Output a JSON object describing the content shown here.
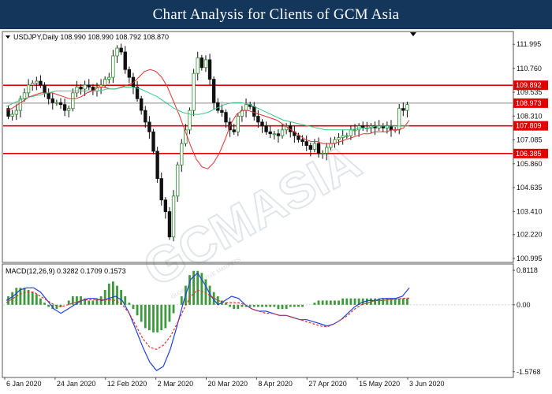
{
  "header": {
    "title": "Chart Analysis for Clients of GCM Asia"
  },
  "colors": {
    "banner_bg": "#13365a",
    "candle_up": "#2e8b2e",
    "candle_down": "#111111",
    "ma_fast": "#e53030",
    "ma_slow": "#38c98a",
    "level_line": "#e00000",
    "level_label_bg": "#e00000",
    "current_price_bg": "#e00000",
    "macd_hist": "#3c9a3c",
    "macd_line": "#2040e0",
    "signal_line": "#e03030",
    "watermark": "#d8dde2"
  },
  "chart_data": [
    {
      "type": "candlestick",
      "header_text": "USDJPY,Daily  108.990 108.990 108.792 108.870",
      "ohlc": {
        "symbol": "USDJPY",
        "timeframe": "Daily",
        "open": 108.99,
        "high": 108.99,
        "low": 108.792,
        "close": 108.87
      },
      "y_ticks": [
        "111.995",
        "110.760",
        "109.535",
        "108.310",
        "107.085",
        "105.860",
        "104.635",
        "103.410",
        "102.220",
        "100.995"
      ],
      "y_tick_values": [
        111.995,
        110.76,
        109.535,
        108.31,
        107.085,
        105.86,
        104.635,
        103.41,
        102.22,
        100.995
      ],
      "ylim": [
        100.995,
        112.45
      ],
      "x_ticks": [
        "6 Jan 2020",
        "24 Jan 2020",
        "12 Feb 2020",
        "2 Mar 2020",
        "20 Mar 2020",
        "8 Apr 2020",
        "27 Apr 2020",
        "15 May 2020",
        "3 Jun 2020"
      ],
      "levels": [
        {
          "label": "109.892",
          "value": 109.892
        },
        {
          "label": "107.809",
          "value": 107.809
        },
        {
          "label": "106.385",
          "value": 106.385
        }
      ],
      "current_price": {
        "label": "108.973",
        "value": 108.973
      },
      "close_series": [
        108.3,
        108.4,
        108.6,
        109.2,
        109.5,
        109.9,
        110.0,
        110.1,
        109.9,
        109.5,
        109.2,
        109.0,
        109.0,
        108.9,
        108.6,
        108.7,
        109.5,
        109.8,
        109.7,
        109.9,
        109.8,
        109.6,
        109.8,
        109.9,
        110.2,
        110.3,
        111.4,
        111.8,
        111.6,
        110.7,
        110.3,
        109.8,
        109.2,
        108.6,
        108.0,
        107.5,
        106.5,
        105.1,
        104.0,
        103.4,
        102.1,
        104.2,
        105.8,
        106.9,
        107.6,
        108.6,
        110.5,
        111.3,
        110.8,
        111.2,
        110.2,
        109.0,
        108.6,
        108.5,
        108.0,
        107.6,
        107.5,
        108.3,
        108.6,
        108.9,
        108.8,
        108.3,
        108.0,
        107.8,
        107.5,
        107.4,
        107.4,
        107.3,
        107.6,
        107.8,
        107.5,
        107.3,
        107.1,
        107.0,
        106.8,
        106.6,
        106.9,
        106.4,
        106.4,
        106.7,
        106.9,
        107.1,
        107.2,
        107.3,
        107.3,
        107.6,
        107.6,
        107.8,
        107.7,
        107.7,
        107.8,
        107.7,
        107.8,
        107.7,
        107.8,
        107.6,
        107.6,
        108.7,
        108.6,
        108.9
      ],
      "open_series": [
        108.7,
        108.3,
        108.4,
        108.6,
        109.2,
        109.5,
        109.9,
        110.0,
        110.1,
        109.9,
        109.5,
        109.2,
        109.0,
        109.0,
        108.9,
        108.6,
        108.7,
        109.5,
        109.8,
        109.7,
        109.9,
        109.8,
        109.6,
        109.8,
        109.9,
        110.2,
        110.3,
        111.4,
        111.8,
        111.6,
        110.7,
        110.3,
        109.8,
        109.2,
        108.6,
        108.0,
        107.5,
        106.5,
        105.1,
        104.0,
        103.4,
        102.1,
        104.2,
        105.8,
        106.9,
        107.6,
        108.6,
        110.5,
        111.3,
        110.8,
        111.2,
        110.2,
        109.0,
        108.6,
        108.5,
        108.0,
        107.6,
        107.5,
        108.3,
        108.6,
        108.9,
        108.8,
        108.3,
        108.0,
        107.8,
        107.5,
        107.4,
        107.4,
        107.3,
        107.6,
        107.8,
        107.5,
        107.3,
        107.1,
        107.0,
        106.8,
        106.6,
        106.9,
        106.4,
        106.4,
        106.7,
        106.9,
        107.1,
        107.2,
        107.3,
        107.3,
        107.6,
        107.6,
        107.8,
        107.7,
        107.7,
        107.8,
        107.7,
        107.8,
        107.7,
        107.8,
        107.6,
        107.6,
        108.7,
        108.6
      ],
      "series": [
        {
          "name": "MA fast",
          "values": [
            108.6,
            108.7,
            108.9,
            109.1,
            109.3,
            109.4,
            109.5,
            109.5,
            109.5,
            109.4,
            109.3,
            109.2,
            109.2,
            109.3,
            109.5,
            109.6,
            109.8,
            109.8,
            109.7,
            109.7,
            109.8,
            109.9,
            110.0,
            110.3,
            110.6,
            110.7,
            110.6,
            110.3,
            109.8,
            109.1,
            108.4,
            107.6,
            106.8,
            106.1,
            105.7,
            105.6,
            105.9,
            106.4,
            107.1,
            107.9,
            108.4,
            108.6,
            108.6,
            108.5,
            108.4,
            108.3,
            108.2,
            108.1,
            107.9,
            107.7,
            107.5,
            107.3,
            107.1,
            107.0,
            107.0,
            106.9,
            106.9,
            106.9,
            107.0,
            107.1,
            107.2,
            107.3,
            107.4,
            107.4,
            107.5,
            107.5,
            107.5,
            107.6,
            107.6,
            107.7,
            108.1
          ]
        },
        {
          "name": "MA slow",
          "values": [
            108.8,
            109.0,
            109.2,
            109.3,
            109.4,
            109.5,
            109.6,
            109.6,
            109.6,
            109.6,
            109.6,
            109.6,
            109.7,
            109.7,
            109.8,
            109.8,
            109.7,
            109.5,
            109.3,
            109.0,
            108.7,
            108.5,
            108.4,
            108.4,
            108.5,
            108.7,
            108.9,
            109.0,
            109.0,
            108.9,
            108.7,
            108.5,
            108.3,
            108.1,
            108.0,
            107.9,
            107.8,
            107.7,
            107.6,
            107.6,
            107.6,
            107.6,
            107.7,
            107.7,
            107.8,
            107.8,
            107.8,
            107.8,
            107.8
          ]
        }
      ]
    },
    {
      "type": "macd",
      "header_text": "MACD(12,26,9) 0.3282 0.1709 0.1573",
      "params": [
        12,
        26,
        9
      ],
      "values_shown": [
        0.3282,
        0.1709,
        0.1573
      ],
      "y_ticks": [
        "0.8118",
        "0.00",
        "-1.5768"
      ],
      "y_tick_values": [
        0.8118,
        0.0,
        -1.5768
      ],
      "ylim": [
        -1.6,
        0.85
      ],
      "histogram": [
        0.2,
        0.3,
        0.4,
        0.4,
        0.4,
        0.35,
        0.3,
        0.25,
        0.15,
        0.05,
        -0.05,
        -0.1,
        -0.1,
        -0.05,
        0.0,
        0.1,
        0.2,
        0.2,
        0.2,
        0.15,
        0.1,
        0.1,
        0.15,
        0.2,
        0.35,
        0.5,
        0.55,
        0.45,
        0.35,
        0.2,
        0.05,
        -0.1,
        -0.25,
        -0.4,
        -0.55,
        -0.6,
        -0.65,
        -0.65,
        -0.6,
        -0.55,
        -0.4,
        -0.2,
        0.0,
        0.2,
        0.45,
        0.7,
        0.8,
        0.8,
        0.75,
        0.6,
        0.45,
        0.3,
        0.2,
        0.1,
        0.05,
        -0.05,
        -0.1,
        -0.1,
        -0.05,
        -0.05,
        -0.05,
        -0.05,
        -0.05,
        -0.05,
        -0.05,
        -0.05,
        -0.05,
        -0.1,
        -0.1,
        -0.1,
        -0.05,
        -0.05,
        -0.05,
        -0.05,
        0.0,
        0.0,
        0.05,
        0.1,
        0.1,
        0.1,
        0.1,
        0.1,
        0.1,
        0.15,
        0.15,
        0.15,
        0.15,
        0.15,
        0.15,
        0.15,
        0.15,
        0.15,
        0.15,
        0.15,
        0.15,
        0.15,
        0.15,
        0.15,
        0.15,
        0.15
      ],
      "series": [
        {
          "name": "MACD",
          "values": [
            0.1,
            0.2,
            0.35,
            0.4,
            0.4,
            0.3,
            0.1,
            -0.1,
            -0.2,
            -0.1,
            0.0,
            0.1,
            0.15,
            0.15,
            0.1,
            0.15,
            0.2,
            0.1,
            -0.2,
            -0.6,
            -1.0,
            -1.35,
            -1.55,
            -1.45,
            -1.05,
            -0.5,
            0.1,
            0.6,
            0.75,
            0.5,
            0.2,
            0.0,
            0.1,
            0.2,
            0.15,
            0.0,
            -0.1,
            -0.15,
            -0.15,
            -0.2,
            -0.25,
            -0.25,
            -0.3,
            -0.35,
            -0.35,
            -0.4,
            -0.45,
            -0.5,
            -0.45,
            -0.35,
            -0.2,
            -0.05,
            0.05,
            0.1,
            0.1,
            0.15,
            0.15,
            0.15,
            0.2,
            0.4
          ]
        },
        {
          "name": "Signal",
          "values": [
            0.05,
            0.15,
            0.25,
            0.3,
            0.3,
            0.2,
            0.1,
            0.0,
            -0.05,
            0.0,
            0.05,
            0.1,
            0.12,
            0.12,
            0.12,
            0.12,
            0.1,
            0.0,
            -0.2,
            -0.5,
            -0.8,
            -1.0,
            -1.05,
            -0.95,
            -0.75,
            -0.45,
            -0.1,
            0.2,
            0.35,
            0.3,
            0.2,
            0.1,
            0.05,
            0.05,
            0.05,
            0.0,
            -0.1,
            -0.15,
            -0.2,
            -0.2,
            -0.25,
            -0.25,
            -0.3,
            -0.35,
            -0.4,
            -0.45,
            -0.5,
            -0.52,
            -0.45,
            -0.35,
            -0.25,
            -0.1,
            0.0,
            0.05,
            0.1,
            0.1,
            0.12,
            0.13,
            0.15,
            0.16
          ]
        }
      ]
    }
  ],
  "watermark": {
    "text": "GCMASIA",
    "subtext": "GLOBAL CREATIVE MARKETS"
  }
}
